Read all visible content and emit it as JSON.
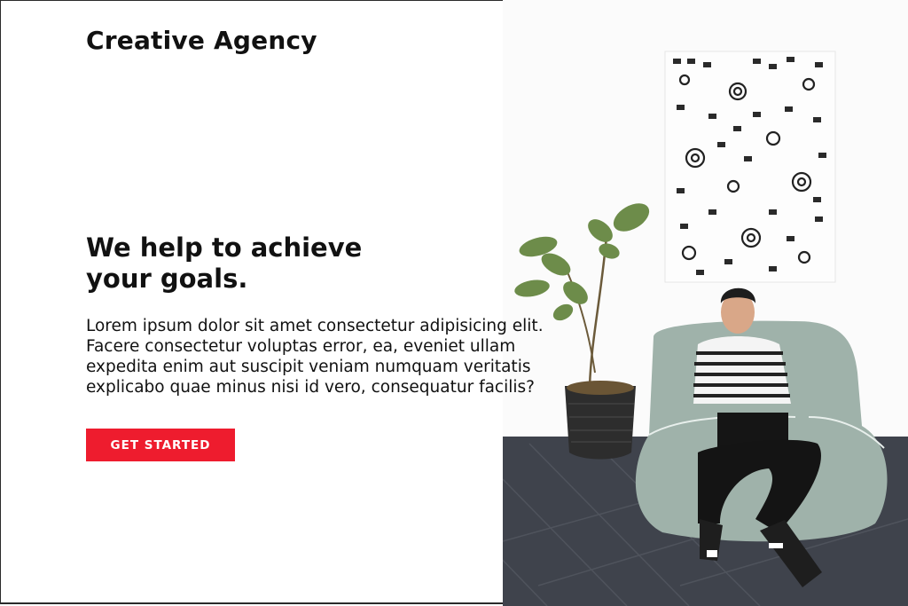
{
  "header": {
    "brand": "Creative Agency",
    "menu_icon": "hamburger-menu-icon"
  },
  "hero": {
    "headline_line1": "We help to achieve",
    "headline_line2": "your goals.",
    "lead_lines": [
      "Lorem ipsum dolor sit amet consectetur adipisicing elit.",
      "Facere consectetur voluptas error, ea, eveniet ullam",
      "expedita enim aut suscipit veniam numquam veritatis",
      "explicabo quae minus nisi id vero, consequatur facilis?"
    ],
    "cta_label": "GET STARTED"
  },
  "colors": {
    "accent": "#ee1c2e",
    "text": "#111111",
    "background": "#ffffff"
  }
}
